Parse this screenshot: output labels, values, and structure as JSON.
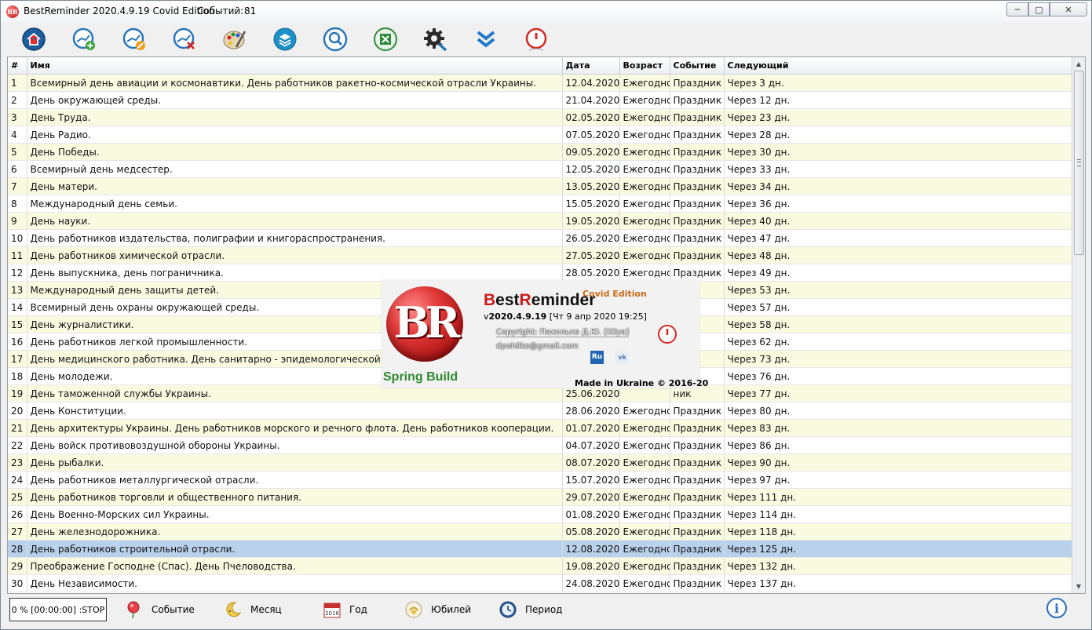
{
  "window": {
    "title": "BestReminder 2020.4.9.19 Covid Edition",
    "events_label": "Событий:",
    "events_count": "81",
    "buttons": {
      "minimize": "─",
      "maximize": "▢",
      "close": "✕"
    }
  },
  "toolbar": {
    "buttons": [
      {
        "name": "home",
        "icon": "home-icon"
      },
      {
        "name": "add-event",
        "icon": "add-event-icon"
      },
      {
        "name": "edit-event",
        "icon": "edit-event-icon"
      },
      {
        "name": "delete-event",
        "icon": "delete-event-icon"
      },
      {
        "name": "skins",
        "icon": "palette-icon"
      },
      {
        "name": "layers",
        "icon": "layers-icon"
      },
      {
        "name": "search",
        "icon": "search-icon"
      },
      {
        "name": "export-excel",
        "icon": "excel-icon"
      },
      {
        "name": "settings",
        "icon": "gear-icon"
      },
      {
        "name": "collapse",
        "icon": "chevron-double-down-icon"
      },
      {
        "name": "power",
        "icon": "power-icon"
      }
    ]
  },
  "table": {
    "columns": [
      "#",
      "Имя",
      "Дата",
      "Возраст",
      "Событие",
      "Следующий"
    ],
    "rows": [
      {
        "n": "1",
        "name": "Всемирный день авиации и космонавтики. День работников ракетно-космической отрасли Украины.",
        "date": "12.04.2020",
        "age": "Ежегодно",
        "event": "Праздник",
        "next": "Через 3 дн."
      },
      {
        "n": "2",
        "name": "День окружающей среды.",
        "date": "21.04.2020",
        "age": "Ежегодно",
        "event": "Праздник",
        "next": "Через 12 дн."
      },
      {
        "n": "3",
        "name": "День Труда.",
        "date": "02.05.2020",
        "age": "Ежегодно",
        "event": "Праздник",
        "next": "Через 23 дн."
      },
      {
        "n": "4",
        "name": "День Радио.",
        "date": "07.05.2020",
        "age": "Ежегодно",
        "event": "Праздник",
        "next": "Через 28 дн."
      },
      {
        "n": "5",
        "name": "День Победы.",
        "date": "09.05.2020",
        "age": "Ежегодно",
        "event": "Праздник",
        "next": "Через 30 дн."
      },
      {
        "n": "6",
        "name": "Всемирный день медсестер.",
        "date": "12.05.2020",
        "age": "Ежегодно",
        "event": "Праздник",
        "next": "Через 33 дн."
      },
      {
        "n": "7",
        "name": "День матери.",
        "date": "13.05.2020",
        "age": "Ежегодно",
        "event": "Праздник",
        "next": "Через 34 дн."
      },
      {
        "n": "8",
        "name": "Международный день семьи.",
        "date": "15.05.2020",
        "age": "Ежегодно",
        "event": "Праздник",
        "next": "Через 36 дн."
      },
      {
        "n": "9",
        "name": "День науки.",
        "date": "19.05.2020",
        "age": "Ежегодно",
        "event": "Праздник",
        "next": "Через 40 дн."
      },
      {
        "n": "10",
        "name": "День работников издательства, полиграфии и книгораспространения.",
        "date": "26.05.2020",
        "age": "Ежегодно",
        "event": "Праздник",
        "next": "Через 47 дн."
      },
      {
        "n": "11",
        "name": "День работников химической отрасли.",
        "date": "27.05.2020",
        "age": "Ежегодно",
        "event": "Праздник",
        "next": "Через 48 дн."
      },
      {
        "n": "12",
        "name": "День выпускника, день пограничника.",
        "date": "28.05.2020",
        "age": "Ежегодно",
        "event": "Праздник",
        "next": "Через 49 дн."
      },
      {
        "n": "13",
        "name": "Международный день защиты детей.",
        "date": "",
        "age": "",
        "event": "ник",
        "next": "Через 53 дн."
      },
      {
        "n": "14",
        "name": "Всемирный день охраны окружающей среды.",
        "date": "",
        "age": "",
        "event": "ник",
        "next": "Через 57 дн."
      },
      {
        "n": "15",
        "name": "День журналистики.",
        "date": "",
        "age": "",
        "event": "ник",
        "next": "Через 58 дн."
      },
      {
        "n": "16",
        "name": "День работников легкой промышленности.",
        "date": "",
        "age": "",
        "event": "ник",
        "next": "Через 62 дн."
      },
      {
        "n": "17",
        "name": "День медицинского работника. День санитарно - эпидемологической службы",
        "date": "",
        "age": "",
        "event": "ник",
        "next": "Через 73 дн."
      },
      {
        "n": "18",
        "name": "День молодежи.",
        "date": "",
        "age": "",
        "event": "ник",
        "next": "Через 76 дн."
      },
      {
        "n": "19",
        "name": "День таможенной службы Украины.",
        "date": "25.06.2020",
        "age": "",
        "event": "ник",
        "next": "Через 77 дн."
      },
      {
        "n": "20",
        "name": "День Конституции.",
        "date": "28.06.2020",
        "age": "Ежегодно",
        "event": "Праздник",
        "next": "Через 80 дн."
      },
      {
        "n": "21",
        "name": "День архитектуры Украины. День работников морского и речного флота. День работников кооперации.",
        "date": "01.07.2020",
        "age": "Ежегодно",
        "event": "Праздник",
        "next": "Через 83 дн."
      },
      {
        "n": "22",
        "name": "День войск противовоздушной обороны Украины.",
        "date": "04.07.2020",
        "age": "Ежегодно",
        "event": "Праздник",
        "next": "Через 86 дн."
      },
      {
        "n": "23",
        "name": "День рыбалки.",
        "date": "08.07.2020",
        "age": "Ежегодно",
        "event": "Праздник",
        "next": "Через 90 дн."
      },
      {
        "n": "24",
        "name": "День работников металлургической отрасли.",
        "date": "15.07.2020",
        "age": "Ежегодно",
        "event": "Праздник",
        "next": "Через 97 дн."
      },
      {
        "n": "25",
        "name": "День работников торговли и общественного питания.",
        "date": "29.07.2020",
        "age": "Ежегодно",
        "event": "Праздник",
        "next": "Через 111 дн."
      },
      {
        "n": "26",
        "name": "День Военно-Морских сил Украины.",
        "date": "01.08.2020",
        "age": "Ежегодно",
        "event": "Праздник",
        "next": "Через 114 дн."
      },
      {
        "n": "27",
        "name": "День железнодорожника.",
        "date": "05.08.2020",
        "age": "Ежегодно",
        "event": "Праздник",
        "next": "Через 118 дн."
      },
      {
        "n": "28",
        "name": "День работников строительной отрасли.",
        "date": "12.08.2020",
        "age": "Ежегодно",
        "event": "Праздник",
        "next": "Через 125 дн."
      },
      {
        "n": "29",
        "name": "Преображение Господне (Спас). День Пчеловодства.",
        "date": "19.08.2020",
        "age": "Ежегодно",
        "event": "Праздник",
        "next": "Через 132 дн."
      },
      {
        "n": "30",
        "name": "День Независимости.",
        "date": "24.08.2020",
        "age": "Ежегодно",
        "event": "Праздник",
        "next": "Через 137 дн."
      }
    ],
    "selected_row": 28
  },
  "splash": {
    "logo_text": "BR",
    "build_label": "Spring Build",
    "title_part1": "Best",
    "title_r1": "R",
    "title_part2": "eminder",
    "edition": "Covid Edition",
    "version_prefix": "v",
    "version": "2020.4.9.19",
    "version_date": "[Чт 9 апр 2020 19:25]",
    "copyright": "Copyright: Похилько Д.Ю. [Kilya]",
    "email": "dpohilko@gmail.com",
    "ru_button": "Ru",
    "vk_button": "vk",
    "made_in": "Made in Ukraine © 2016-20"
  },
  "statusbar": {
    "progress": "0 % [00:00:00] :STOP",
    "items": [
      {
        "label": "Событие",
        "icon": "balloon-icon"
      },
      {
        "label": "Месяц",
        "icon": "moon-icon"
      },
      {
        "label": "Год",
        "icon": "calendar-icon"
      },
      {
        "label": "Юбилей",
        "icon": "anniversary-icon"
      },
      {
        "label": "Период",
        "icon": "clock-icon"
      }
    ],
    "info_button": "i"
  }
}
